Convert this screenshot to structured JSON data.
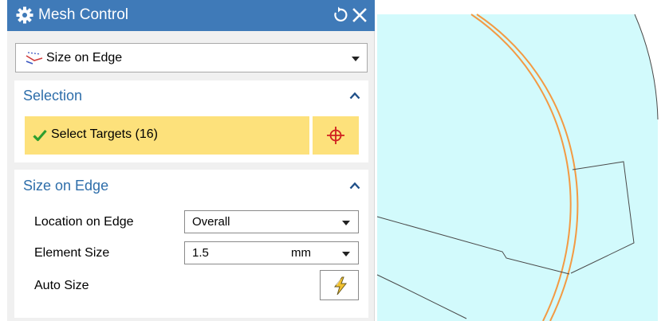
{
  "dialog": {
    "title": "Mesh Control",
    "type_selector": {
      "value": "Size on Edge"
    }
  },
  "selection": {
    "title": "Selection",
    "select_targets_label": "Select Targets (16)"
  },
  "size_on_edge": {
    "title": "Size on Edge",
    "location": {
      "label": "Location on Edge",
      "value": "Overall"
    },
    "element_size": {
      "label": "Element Size",
      "value": "1.5",
      "unit": "mm"
    },
    "auto_size": {
      "label": "Auto Size"
    }
  },
  "icons": {
    "title": "gear-icon",
    "reset": "reset-icon",
    "close": "close-icon",
    "type": "edge-size-icon",
    "check": "check-icon",
    "crosshair": "crosshair-icon",
    "auto": "lightning-icon"
  },
  "colors": {
    "titlebar": "#3f7ab8",
    "section_title": "#2e6eaa",
    "selection_highlight": "#fde17b",
    "model_fill": "#d2fafc",
    "edge_highlight": "#f39a43"
  }
}
